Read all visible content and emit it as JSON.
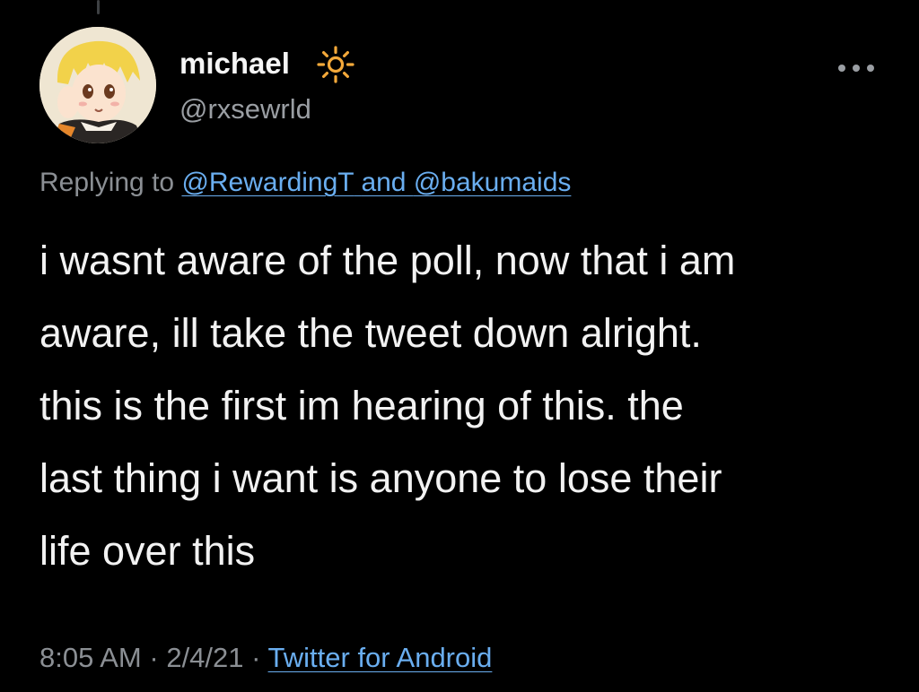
{
  "author": {
    "display_name": "michael",
    "handle": "@rxsewrld",
    "name_emoji": "sun-icon"
  },
  "menu": {
    "icon": "more-horizontal-icon"
  },
  "reply_context": {
    "prefix": "Replying to",
    "mention_1": "@RewardingT",
    "connector": "and",
    "mention_2": "@bakumaids"
  },
  "tweet": {
    "lines": [
      "i wasnt aware of the poll, now that i am",
      "aware, ill take the tweet down alright.",
      "this is the first im hearing of this. the",
      "last thing i want is anyone to lose their",
      "life over this"
    ]
  },
  "meta": {
    "time": "8:05 AM",
    "separator": "·",
    "date": "2/4/21",
    "source": "Twitter for Android"
  },
  "colors": {
    "background": "#000000",
    "link": "#6aaef0",
    "secondary_text": "#8b8f94",
    "sun_emoji": "#f4a93a"
  }
}
